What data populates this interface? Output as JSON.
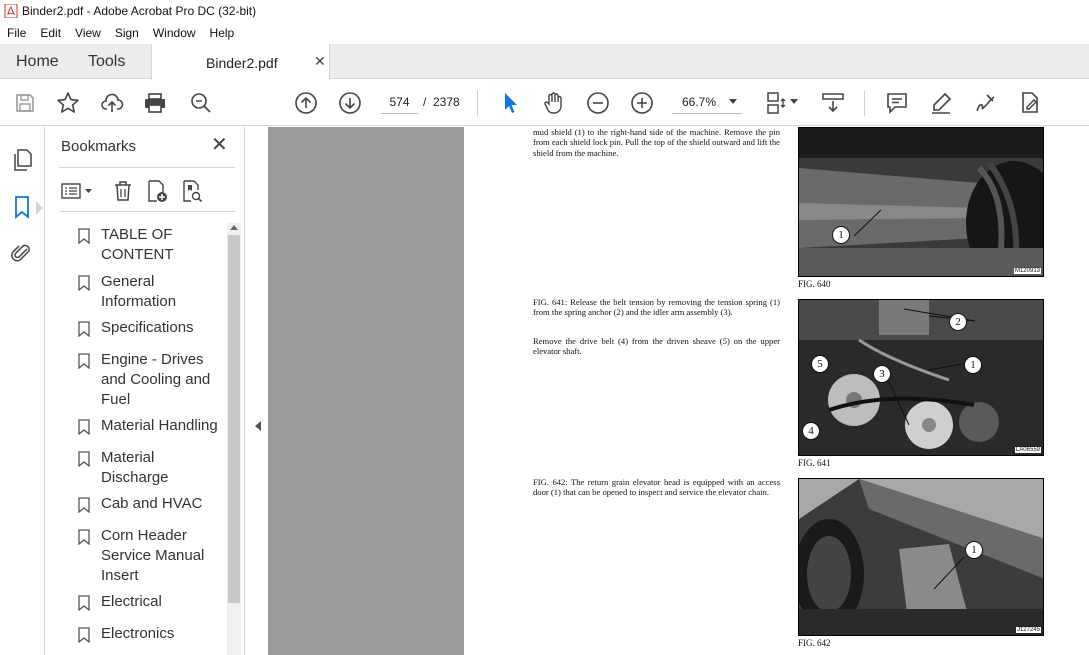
{
  "window": {
    "title": "Binder2.pdf - Adobe Acrobat Pro DC (32-bit)"
  },
  "menu": [
    "File",
    "Edit",
    "View",
    "Sign",
    "Window",
    "Help"
  ],
  "tabs": {
    "home": "Home",
    "tools": "Tools",
    "document": "Binder2.pdf"
  },
  "toolbar": {
    "current_page": "574",
    "page_separator": "/",
    "total_pages": "2378",
    "zoom": "66.7%"
  },
  "bookmarks": {
    "title": "Bookmarks",
    "items": [
      "TABLE OF CONTENT",
      "General Information",
      "Specifications",
      "Engine - Drives and Cooling and Fuel",
      "Material Handling",
      "Material Discharge",
      "Cab and HVAC",
      "Corn Header Service Manual Insert",
      "Electrical",
      "Electronics"
    ]
  },
  "document": {
    "fig640_text": "mud shield (1) to the right-hand side of the machine. Remove the pin from each shield lock pin. Pull the top of the shield outward and lift the shield from the machine.",
    "fig641_text1": "FIG. 641: Release the belt tension by removing the tension spring (1) from the spring anchor (2) and the idler arm assembly (3).",
    "fig641_text2": "Remove the drive belt (4) from the driven sheave (5) on the upper elevator shaft.",
    "fig642_text": "FIG. 642: The return grain elevator head is equipped with an access door (1) that can be opened to inspect and service the elevator chain.",
    "figures": [
      {
        "caption": "FIG. 640",
        "code": "M120913",
        "callouts": [
          "1"
        ]
      },
      {
        "caption": "FIG. 641",
        "code": "LA06559",
        "callouts": [
          "2",
          "5",
          "3",
          "1",
          "4"
        ]
      },
      {
        "caption": "FIG. 642",
        "code": "J127245",
        "callouts": [
          "1"
        ]
      }
    ]
  },
  "colors": {
    "pdf_icon": "#d0312d",
    "selected_tool": "#1473e6",
    "doc_background": "#9a9a9a"
  }
}
